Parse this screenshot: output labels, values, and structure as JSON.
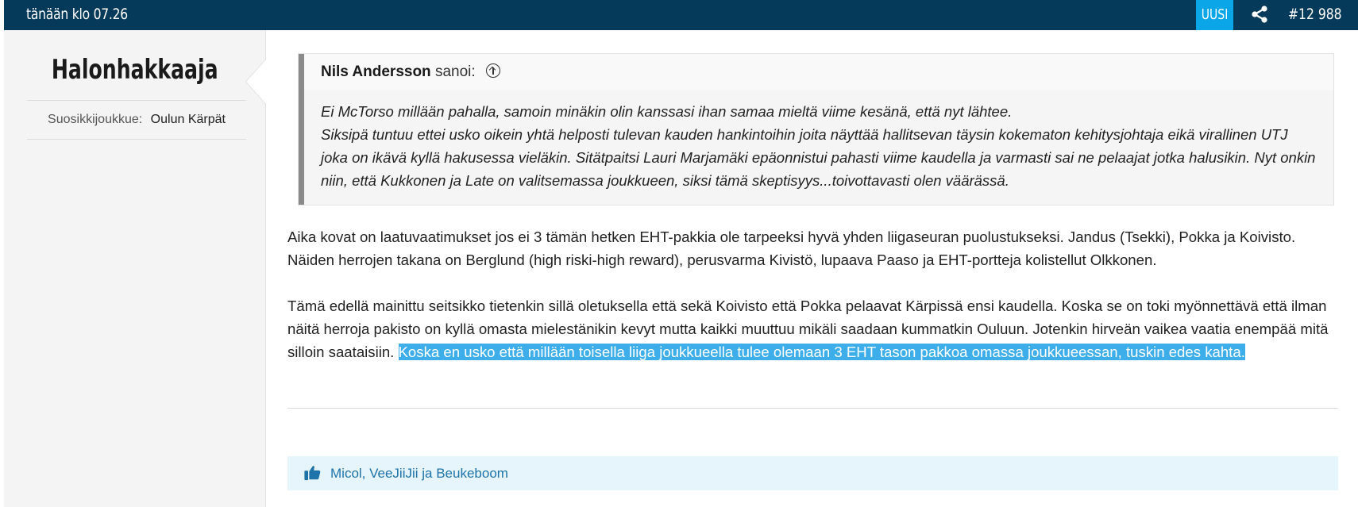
{
  "header": {
    "timestamp": "tänään klo 07.26",
    "new_badge": "UUSI",
    "share_icon": "share-icon",
    "post_number": "#12 988",
    "bar_color": "#063a5a",
    "badge_color": "#0aa6e8"
  },
  "author": {
    "nickname": "Halonhakkaaja",
    "favorite_label": "Suosikkijoukkue:",
    "favorite_team": "Oulun Kärpät"
  },
  "quote": {
    "author": "Nils Andersson",
    "said": "sanoi:",
    "jump_icon": "arrow-up-circle-icon",
    "line1": "Ei McTorso millään pahalla, samoin minäkin olin kanssasi ihan samaa mieltä viime kesänä, että nyt lähtee.",
    "line2": "Siksipä tuntuu ettei usko oikein yhtä helposti tulevan kauden hankintoihin joita näyttää hallitsevan täysin kokematon kehitysjohtaja eikä virallinen UTJ joka on ikävä kyllä hakusessa vieläkin. Sitätpaitsi Lauri Marjamäki epäonnistui pahasti viime kaudella ja varmasti sai ne pelaajat jotka halusikin. Nyt onkin niin, että Kukkonen ja Late on valitsemassa joukkueen, siksi tämä skeptisyys...toivottavasti olen väärässä."
  },
  "post": {
    "paragraph1": "Aika kovat on laatuvaatimukset jos ei 3 tämän hetken EHT-pakkia ole tarpeeksi hyvä yhden liigaseuran puolustukseksi. Jandus (Tsekki), Pokka ja Koivisto. Näiden herrojen takana on Berglund (high riski-high reward), perusvarma Kivistö, lupaava Paaso ja EHT-portteja kolistellut Olkkonen.",
    "paragraph2_plain": "Tämä edellä mainittu seitsikko tietenkin sillä oletuksella että sekä Koivisto että Pokka pelaavat Kärpissä ensi kaudella. Koska se on toki myönnettävä että ilman näitä herroja pakisto on kyllä omasta mielestänikin kevyt mutta kaikki muuttuu mikäli saadaan kummatkin Ouluun. Jotenkin hirveän vaikea vaatia enempää mitä silloin saataisiin. ",
    "paragraph2_selected": "Koska en usko että millään toisella liiga joukkueella tulee olemaan 3 EHT tason pakkoa omassa joukkueessan, tuskin edes kahta.",
    "selection_color": "#3daee9"
  },
  "reactions": {
    "icon": "thumbs-up-icon",
    "likers": "Micol, VeeJiiJii ja Beukeboom"
  }
}
